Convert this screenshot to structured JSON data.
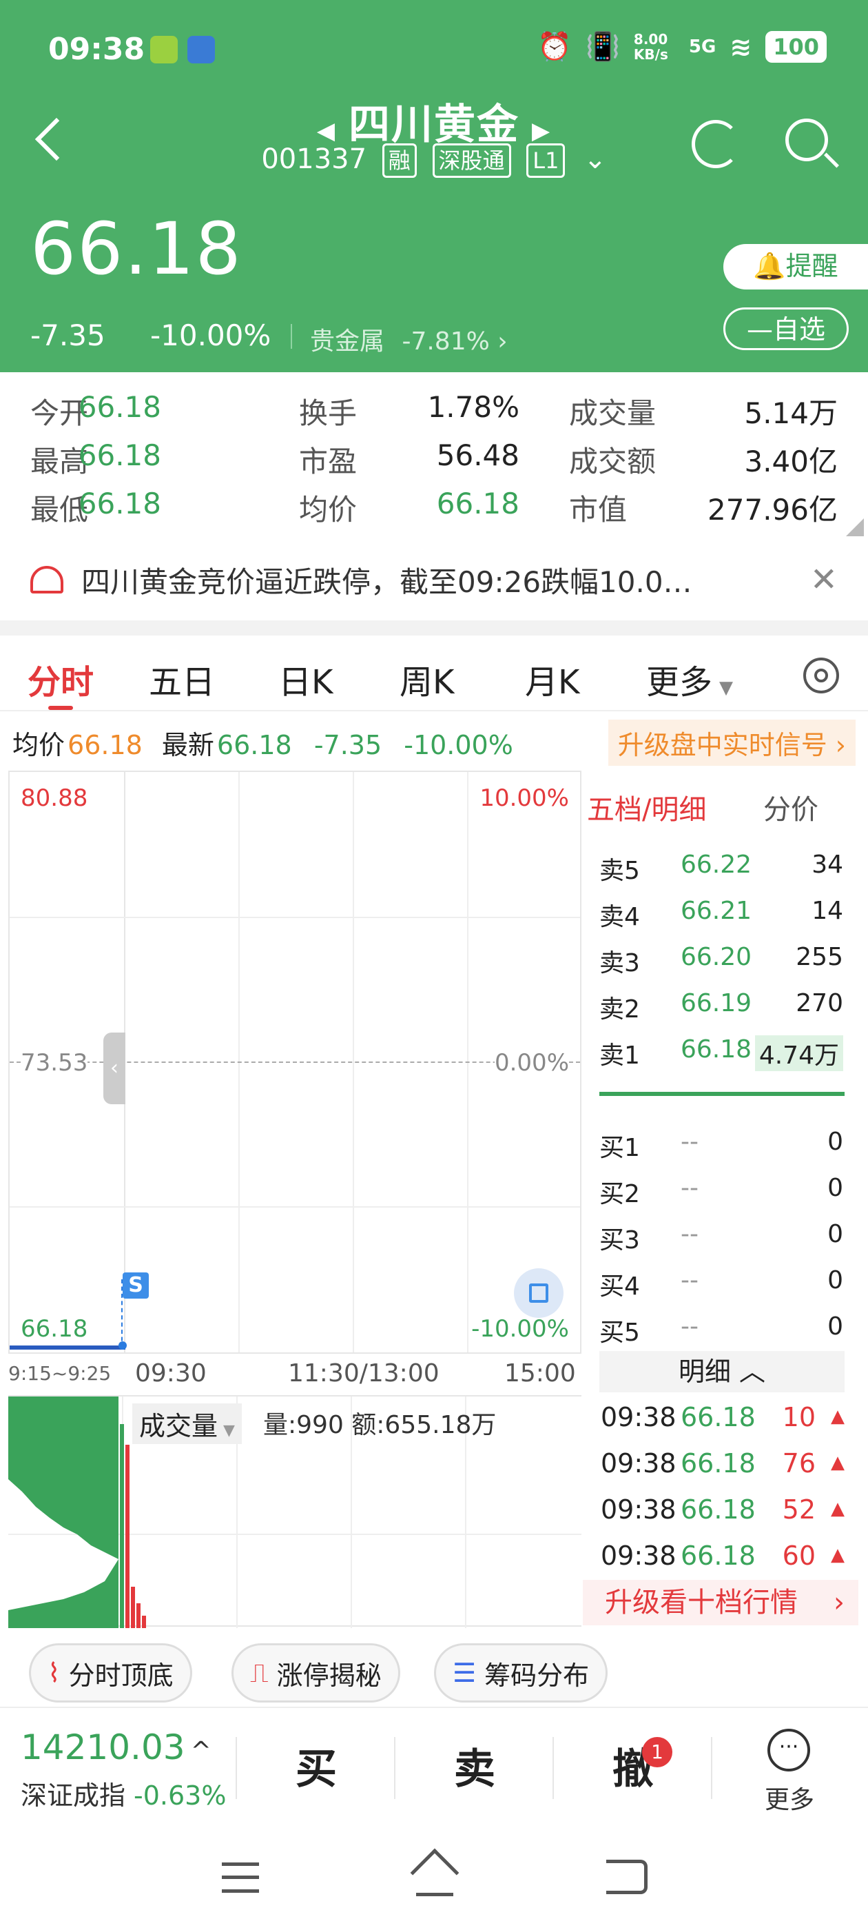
{
  "status": {
    "time": "09:38",
    "speed": "8.00 KB/s",
    "net": "5G",
    "battery": "100"
  },
  "header": {
    "title": "四川黄金",
    "code": "001337",
    "tags": [
      "融",
      "深股通",
      "L1"
    ]
  },
  "quote": {
    "price": "66.18",
    "change": "-7.35",
    "change_pct": "-10.00%",
    "sector": "贵金属",
    "sector_pct": "-7.81%",
    "remind_label": "提醒",
    "watch_label": "自选"
  },
  "stats": [
    {
      "label": "今开",
      "value": "66.18",
      "color": "#3aa35a"
    },
    {
      "label": "换手",
      "value": "1.78%",
      "color": "#222"
    },
    {
      "label": "成交量",
      "value": "5.14万",
      "color": "#222"
    },
    {
      "label": "最高",
      "value": "66.18",
      "color": "#3aa35a"
    },
    {
      "label": "市盈",
      "value": "56.48",
      "color": "#222"
    },
    {
      "label": "成交额",
      "value": "3.40亿",
      "color": "#222"
    },
    {
      "label": "最低",
      "value": "66.18",
      "color": "#3aa35a"
    },
    {
      "label": "均价",
      "value": "66.18",
      "color": "#3aa35a"
    },
    {
      "label": "市值",
      "value": "277.96亿",
      "color": "#222"
    }
  ],
  "banner": {
    "text": "四川黄金竞价逼近跌停，截至09:26跌幅10.0…"
  },
  "tabs": [
    "分时",
    "五日",
    "日K",
    "周K",
    "月K",
    "更多"
  ],
  "infoline": {
    "avg_label": "均价",
    "avg": "66.18",
    "last_label": "最新",
    "last": "66.18",
    "chg": "-7.35",
    "pct": "-10.00%",
    "upgrade": "升级盘中实时信号"
  },
  "chart": {
    "y_top": "80.88",
    "y_mid": "73.53",
    "y_bot": "66.18",
    "pct_top": "10.00%",
    "pct_mid": "0.00%",
    "pct_bot": "-10.00%",
    "x_labels": [
      "9:15~9:25",
      "09:30",
      "11:30/13:00",
      "15:00"
    ],
    "marker": "S",
    "vol_label": "成交量",
    "vol_text": "量:990 额:655.18万"
  },
  "orderbook": {
    "title": "五档/明细",
    "tab2": "分价",
    "sells": [
      {
        "label": "卖5",
        "price": "66.22",
        "vol": "34"
      },
      {
        "label": "卖4",
        "price": "66.21",
        "vol": "14"
      },
      {
        "label": "卖3",
        "price": "66.20",
        "vol": "255"
      },
      {
        "label": "卖2",
        "price": "66.19",
        "vol": "270"
      },
      {
        "label": "卖1",
        "price": "66.18",
        "vol": "4.74万"
      }
    ],
    "buys": [
      {
        "label": "买1",
        "price": "--",
        "vol": "0"
      },
      {
        "label": "买2",
        "price": "--",
        "vol": "0"
      },
      {
        "label": "买3",
        "price": "--",
        "vol": "0"
      },
      {
        "label": "买4",
        "price": "--",
        "vol": "0"
      },
      {
        "label": "买5",
        "price": "--",
        "vol": "0"
      }
    ],
    "detail_label": "明细",
    "ticks": [
      {
        "time": "09:38",
        "price": "66.18",
        "vol": "10"
      },
      {
        "time": "09:38",
        "price": "66.18",
        "vol": "76"
      },
      {
        "time": "09:38",
        "price": "66.18",
        "vol": "52"
      },
      {
        "time": "09:38",
        "price": "66.18",
        "vol": "60"
      }
    ],
    "upgrade10": "升级看十档行情"
  },
  "chips": [
    "分时顶底",
    "涨停揭秘",
    "筹码分布"
  ],
  "bottom": {
    "index_value": "14210.03",
    "index_name": "深证成指",
    "index_pct": "-0.63%",
    "buy": "买",
    "sell": "卖",
    "cancel": "撤",
    "cancel_badge": "1",
    "more": "更多"
  }
}
